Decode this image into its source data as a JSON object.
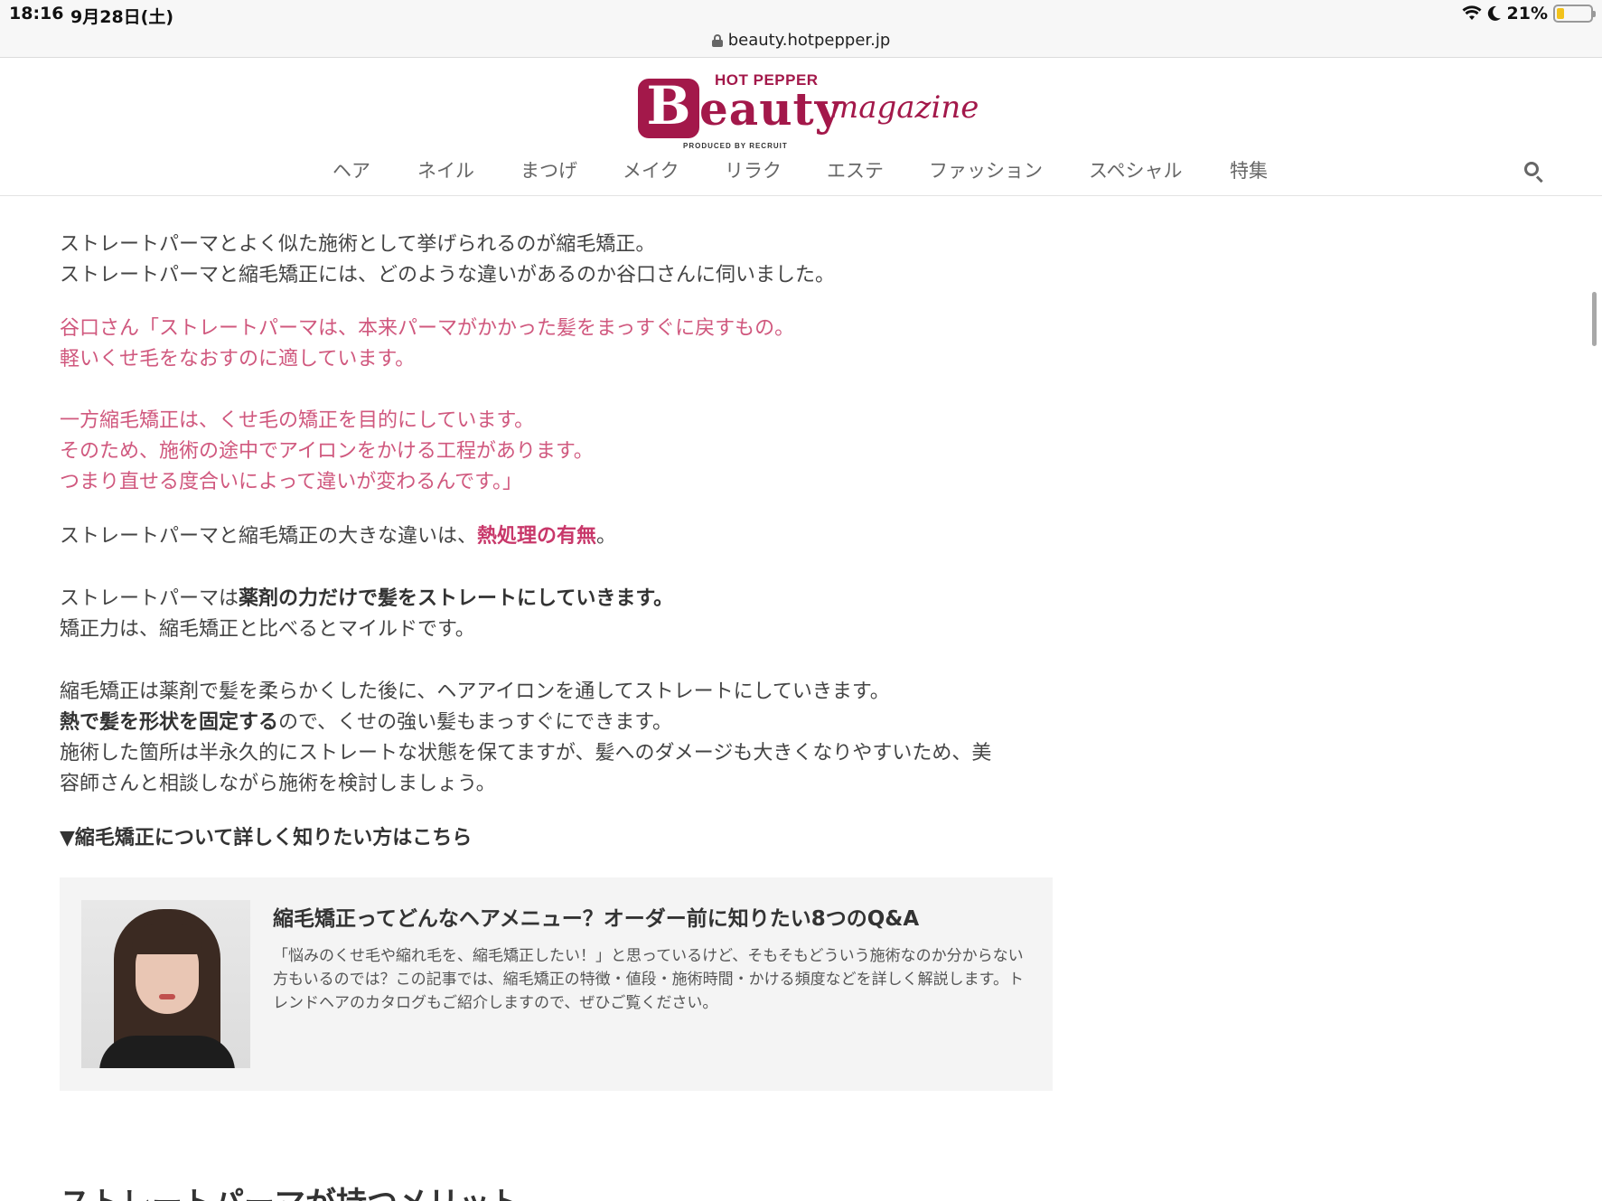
{
  "status_bar": {
    "time": "18:16",
    "date": "9月28日(土)",
    "battery": "21%",
    "battery_level": 0.21
  },
  "url_bar": {
    "url": "beauty.hotpepper.jp"
  },
  "header": {
    "logo_top": "HOT PEPPER",
    "logo_B": "B",
    "logo_eauty": "eauty",
    "logo_mag": "magazine",
    "logo_produced": "PRODUCED BY RECRUIT",
    "nav": [
      "ヘア",
      "ネイル",
      "まつげ",
      "メイク",
      "リラク",
      "エステ",
      "ファッション",
      "スペシャル",
      "特集"
    ]
  },
  "article": {
    "intro_1": "ストレートパーマとよく似た施術として挙げられるのが縮毛矯正。",
    "intro_2": "ストレートパーマと縮毛矯正には、どのような違いがあるのか谷口さんに伺いました。",
    "quote_1": "谷口さん「ストレートパーマは、本来パーマがかかった髪をまっすぐに戻すもの。",
    "quote_2": "軽いくせ毛をなおすのに適しています。",
    "quote_3": "一方縮毛矯正は、くせ毛の矯正を目的にしています。",
    "quote_4": "そのため、施術の途中でアイロンをかける工程があります。",
    "quote_5": "つまり直せる度合いによって違いが変わるんです。」",
    "diff_pre": "ストレートパーマと縮毛矯正の大きな違いは、",
    "diff_bold": "熱処理の有無",
    "diff_post": "。",
    "sp_pre": "ストレートパーマは",
    "sp_bold": "薬剤の力だけで髪をストレートにしていきます。",
    "sp_2": "矯正力は、縮毛矯正と比べるとマイルドです。",
    "sh_1": "縮毛矯正は薬剤で髪を柔らかくした後に、ヘアアイロンを通してストレートにしていきます。",
    "sh_2_bold": "熱で髪を形状を固定する",
    "sh_2_rest": "ので、くせの強い髪もまっすぐにできます。",
    "sh_3": "施術した箇所は半永久的にストレートな状態を保てますが、髪へのダメージも大きくなりやすいため、美",
    "sh_4": "容師さんと相談しながら施術を検討しましょう。",
    "link_heading": "▼縮毛矯正について詳しく知りたい方はこちら"
  },
  "card": {
    "title": "縮毛矯正ってどんなヘアメニュー？オーダー前に知りたい8つのQ&A",
    "description": "「悩みのくせ毛や縮れ毛を、縮毛矯正したい！」と思っているけど、そもそもどういう施術なのか分からない方もいるのでは？この記事では、縮毛矯正の特徴・値段・施術時間・かける頻度などを詳しく解説します。トレンドヘアのカタログもご紹介しますので、ぜひご覧ください。"
  },
  "next_heading": "ストレートパーマが持つメリット",
  "colors": {
    "brand": "#a3184a",
    "quote_pink": "#d0587e",
    "emphasis_pink": "#c8386a",
    "card_bg": "#f4f4f4"
  }
}
